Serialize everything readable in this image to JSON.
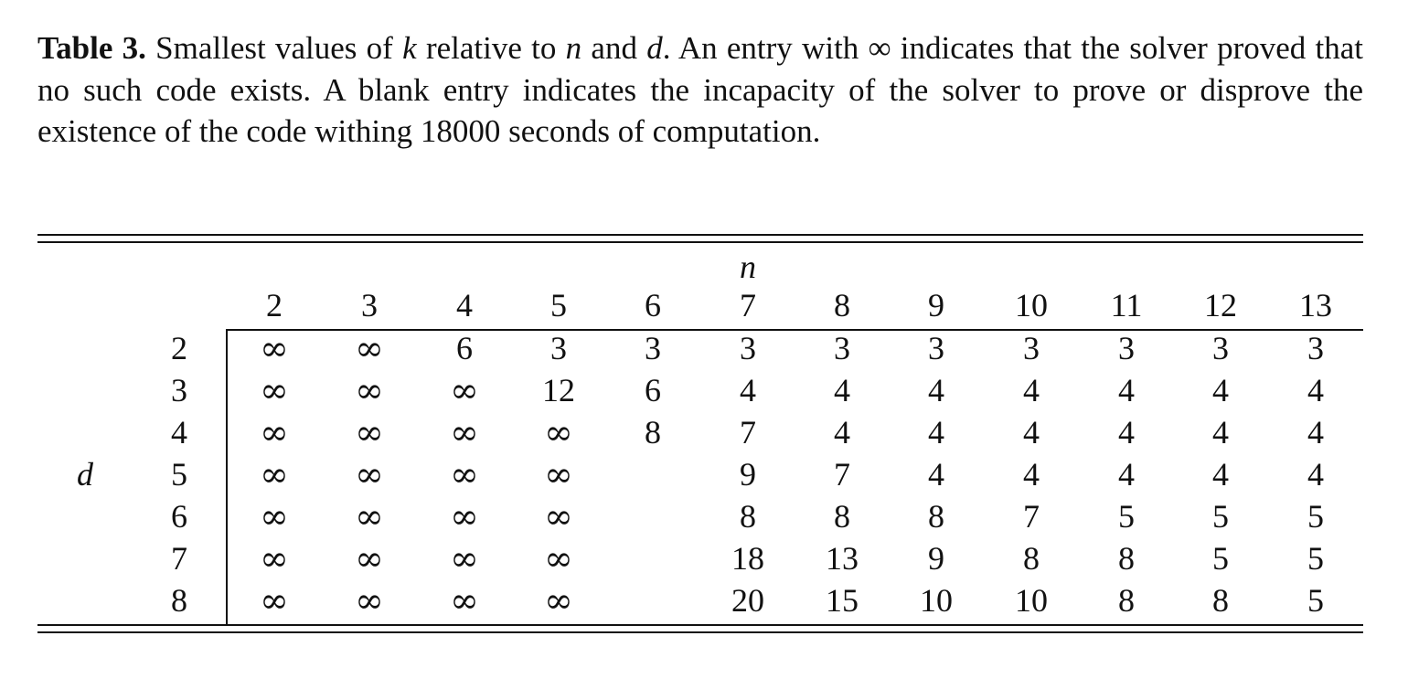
{
  "caption": {
    "label": "Table 3.",
    "text": {
      "p1": "Smallest values of ",
      "k": "k",
      "p2": " relative to ",
      "n": "n",
      "p3": " and ",
      "d": "d",
      "p4": ". An entry with ∞ indicates that the solver proved that no such code exists. A blank entry indicates the incapacity of the solver to prove or disprove the existence of the code withing 18000 seconds of computation."
    }
  },
  "table": {
    "col_header_label": "n",
    "row_header_label": "d",
    "columns": [
      "2",
      "3",
      "4",
      "5",
      "6",
      "7",
      "8",
      "9",
      "10",
      "11",
      "12",
      "13"
    ],
    "rows": [
      {
        "d": "2",
        "cells": [
          "∞",
          "∞",
          "6",
          "3",
          "3",
          "3",
          "3",
          "3",
          "3",
          "3",
          "3",
          "3"
        ]
      },
      {
        "d": "3",
        "cells": [
          "∞",
          "∞",
          "∞",
          "12",
          "6",
          "4",
          "4",
          "4",
          "4",
          "4",
          "4",
          "4"
        ]
      },
      {
        "d": "4",
        "cells": [
          "∞",
          "∞",
          "∞",
          "∞",
          "8",
          "7",
          "4",
          "4",
          "4",
          "4",
          "4",
          "4"
        ]
      },
      {
        "d": "5",
        "cells": [
          "∞",
          "∞",
          "∞",
          "∞",
          "",
          "9",
          "7",
          "4",
          "4",
          "4",
          "4",
          "4"
        ]
      },
      {
        "d": "6",
        "cells": [
          "∞",
          "∞",
          "∞",
          "∞",
          "",
          "8",
          "8",
          "8",
          "7",
          "5",
          "5",
          "5"
        ]
      },
      {
        "d": "7",
        "cells": [
          "∞",
          "∞",
          "∞",
          "∞",
          "",
          "18",
          "13",
          "9",
          "8",
          "8",
          "5",
          "5"
        ]
      },
      {
        "d": "8",
        "cells": [
          "∞",
          "∞",
          "∞",
          "∞",
          "",
          "20",
          "15",
          "10",
          "10",
          "8",
          "8",
          "5"
        ]
      }
    ]
  }
}
